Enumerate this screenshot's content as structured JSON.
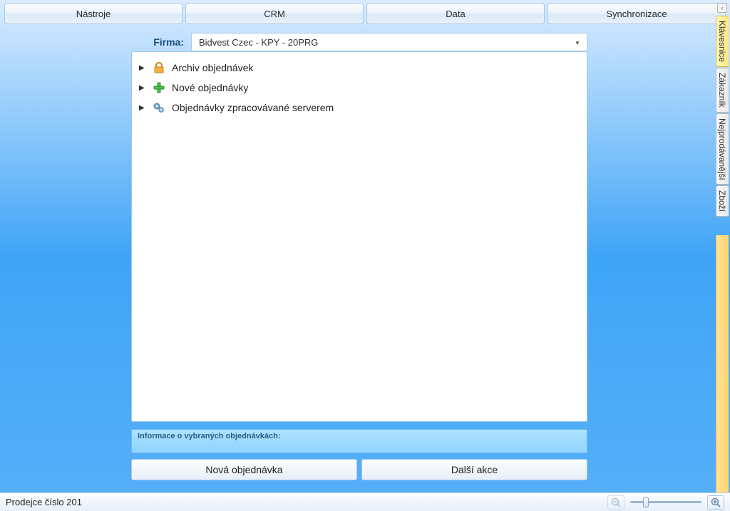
{
  "topbar": {
    "tools": "Nástroje",
    "crm": "CRM",
    "data": "Data",
    "sync": "Synchronizace"
  },
  "firma": {
    "label": "Firma:",
    "selected": "Bidvest Czec - KPY - 20PRG"
  },
  "tree": {
    "items": [
      {
        "label": "Archiv objednávek",
        "icon": "lock"
      },
      {
        "label": "Nové objednávky",
        "icon": "plus"
      },
      {
        "label": "Objednávky zpracovávané serverem",
        "icon": "gears"
      }
    ]
  },
  "info_strip": "Informace o vybraných objednávkách:",
  "actions": {
    "new_order": "Nová objednávka",
    "more": "Další akce"
  },
  "side_tabs": {
    "keyboard": "Klávesnice",
    "customer": "Zákazník",
    "bestselling": "Nejprodávanější",
    "goods": "Zboží"
  },
  "status": {
    "seller": "Prodejce číslo 201"
  }
}
